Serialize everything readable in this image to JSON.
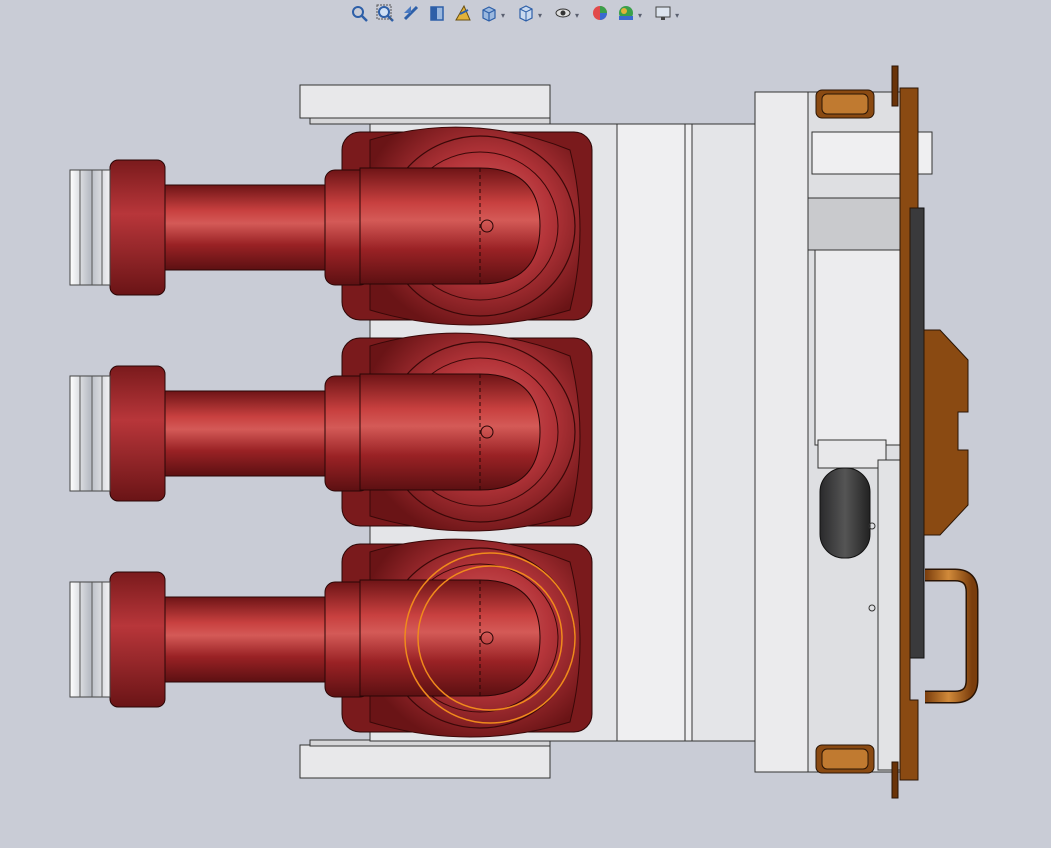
{
  "toolbar": {
    "items": [
      {
        "icon": "zoom-to-fit-icon",
        "has_dropdown": false
      },
      {
        "icon": "zoom-to-area-icon",
        "has_dropdown": false
      },
      {
        "icon": "previous-view-icon",
        "has_dropdown": false
      },
      {
        "icon": "section-view-icon",
        "has_dropdown": false
      },
      {
        "icon": "dynamic-annotation-icon",
        "has_dropdown": false
      },
      {
        "icon": "view-orientation-icon",
        "has_dropdown": true
      },
      {
        "icon": "display-style-icon",
        "has_dropdown": true
      },
      {
        "icon": "hide-show-items-icon",
        "has_dropdown": true
      },
      {
        "icon": "edit-appearance-icon",
        "has_dropdown": false
      },
      {
        "icon": "apply-scene-icon",
        "has_dropdown": true
      },
      {
        "icon": "view-settings-icon",
        "has_dropdown": true
      }
    ],
    "dropdown_glyph": "▾"
  },
  "colors": {
    "background": "#c9ccd6",
    "insulator_red": "#a3262a",
    "insulator_dark": "#6b1518",
    "frame_light": "#e6e7ea",
    "bronze": "#8a4a12",
    "selection_orange": "#f08a1c"
  }
}
